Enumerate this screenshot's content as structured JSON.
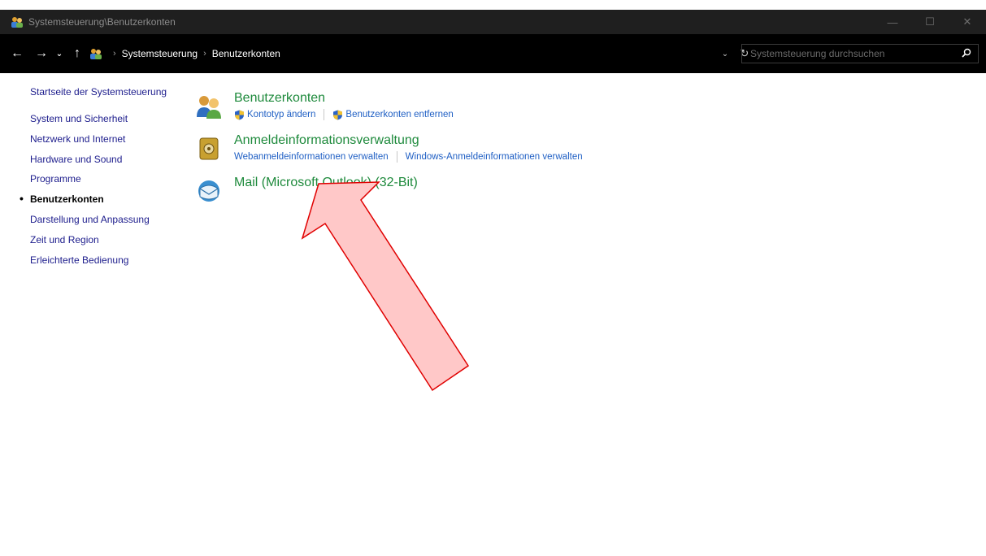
{
  "window": {
    "title": "Systemsteuerung\\Benutzerkonten",
    "controls": {
      "minimize": "—",
      "maximize": "☐",
      "close": "✕"
    }
  },
  "addressbar": {
    "back": "←",
    "forward": "→",
    "recent": "⌄",
    "up": "↑",
    "breadcrumbs": [
      "Systemsteuerung",
      "Benutzerkonten"
    ],
    "dropdown": "⌄",
    "refresh": "↻",
    "search_placeholder": "Systemsteuerung durchsuchen",
    "search_icon": "⌕"
  },
  "leftnav": {
    "home": "Startseite der Systemsteuerung",
    "items": [
      {
        "label": "System und Sicherheit",
        "active": false
      },
      {
        "label": "Netzwerk und Internet",
        "active": false
      },
      {
        "label": "Hardware und Sound",
        "active": false
      },
      {
        "label": "Programme",
        "active": false
      },
      {
        "label": "Benutzerkonten",
        "active": true
      },
      {
        "label": "Darstellung und Anpassung",
        "active": false
      },
      {
        "label": "Zeit und Region",
        "active": false
      },
      {
        "label": "Erleichterte Bedienung",
        "active": false
      }
    ]
  },
  "main": {
    "groups": [
      {
        "title": "Benutzerkonten",
        "icon": "users-icon",
        "links": [
          "Kontotyp ändern",
          "Benutzerkonten entfernen"
        ]
      },
      {
        "title": "Anmeldeinformationsverwaltung",
        "icon": "credential-vault-icon",
        "links": [
          "Webanmeldeinformationen verwalten",
          "Windows-Anmeldeinformationen verwalten"
        ]
      },
      {
        "title": "Mail (Microsoft Outlook) (32-Bit)",
        "icon": "mail-icon",
        "links": []
      }
    ]
  },
  "colors": {
    "titlebar_bg": "#1f1f1f",
    "addressbar_bg": "#000000",
    "group_title": "#1e8a3c",
    "link": "#1f5fc4",
    "nav_link": "#1c1c8c",
    "arrow_fill": "#ffc8c8",
    "arrow_stroke": "#e00000"
  }
}
